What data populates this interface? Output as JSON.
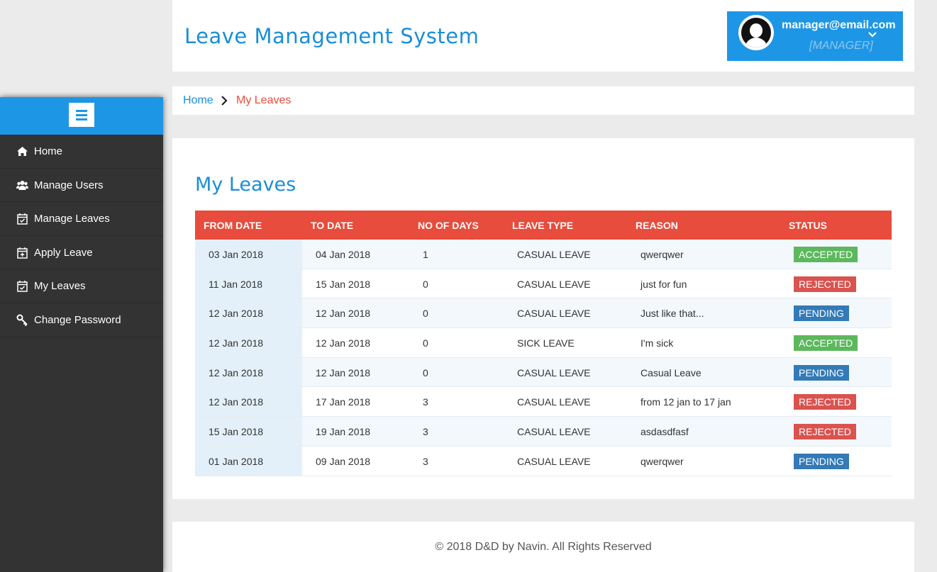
{
  "header": {
    "title": "Leave Management System",
    "user_email": "manager@email.com",
    "user_role": "[MANAGER]"
  },
  "sidebar": {
    "items": [
      {
        "label": "Home",
        "icon": "home-icon"
      },
      {
        "label": "Manage Users",
        "icon": "users-icon"
      },
      {
        "label": "Manage Leaves",
        "icon": "calendar-check-icon"
      },
      {
        "label": "Apply Leave",
        "icon": "calendar-plus-icon"
      },
      {
        "label": "My Leaves",
        "icon": "calendar-check-icon"
      },
      {
        "label": "Change Password",
        "icon": "key-icon"
      }
    ]
  },
  "breadcrumb": {
    "home": "Home",
    "current": "My Leaves"
  },
  "main": {
    "title": "My Leaves",
    "columns": [
      "FROM DATE",
      "TO DATE",
      "NO OF DAYS",
      "LEAVE TYPE",
      "REASON",
      "STATUS"
    ],
    "rows": [
      {
        "from": "03 Jan 2018",
        "to": "04 Jan 2018",
        "days": "1",
        "type": "CASUAL LEAVE",
        "reason": "qwerqwer",
        "status": "ACCEPTED"
      },
      {
        "from": "11 Jan 2018",
        "to": "15 Jan 2018",
        "days": "0",
        "type": "CASUAL LEAVE",
        "reason": "just for fun",
        "status": "REJECTED"
      },
      {
        "from": "12 Jan 2018",
        "to": "12 Jan 2018",
        "days": "0",
        "type": "CASUAL LEAVE",
        "reason": "Just like that...",
        "status": "PENDING"
      },
      {
        "from": "12 Jan 2018",
        "to": "12 Jan 2018",
        "days": "0",
        "type": "SICK LEAVE",
        "reason": "I'm sick",
        "status": "ACCEPTED"
      },
      {
        "from": "12 Jan 2018",
        "to": "12 Jan 2018",
        "days": "0",
        "type": "CASUAL LEAVE",
        "reason": "Casual Leave",
        "status": "PENDING"
      },
      {
        "from": "12 Jan 2018",
        "to": "17 Jan 2018",
        "days": "3",
        "type": "CASUAL LEAVE",
        "reason": "from 12 jan to 17 jan",
        "status": "REJECTED"
      },
      {
        "from": "15 Jan 2018",
        "to": "19 Jan 2018",
        "days": "3",
        "type": "CASUAL LEAVE",
        "reason": "asdasdfasf",
        "status": "REJECTED"
      },
      {
        "from": "01 Jan 2018",
        "to": "09 Jan 2018",
        "days": "3",
        "type": "CASUAL LEAVE",
        "reason": "qwerqwer",
        "status": "PENDING"
      }
    ]
  },
  "status_colors": {
    "ACCEPTED": "#5cb85c",
    "REJECTED": "#d9534f",
    "PENDING": "#337ab7"
  },
  "colors": {
    "accent": "#1e96e6",
    "table_header": "#e74c3c",
    "sidebar_bg": "#333333"
  },
  "footer": {
    "text": "© 2018 D&D by Navin. All Rights Reserved"
  }
}
